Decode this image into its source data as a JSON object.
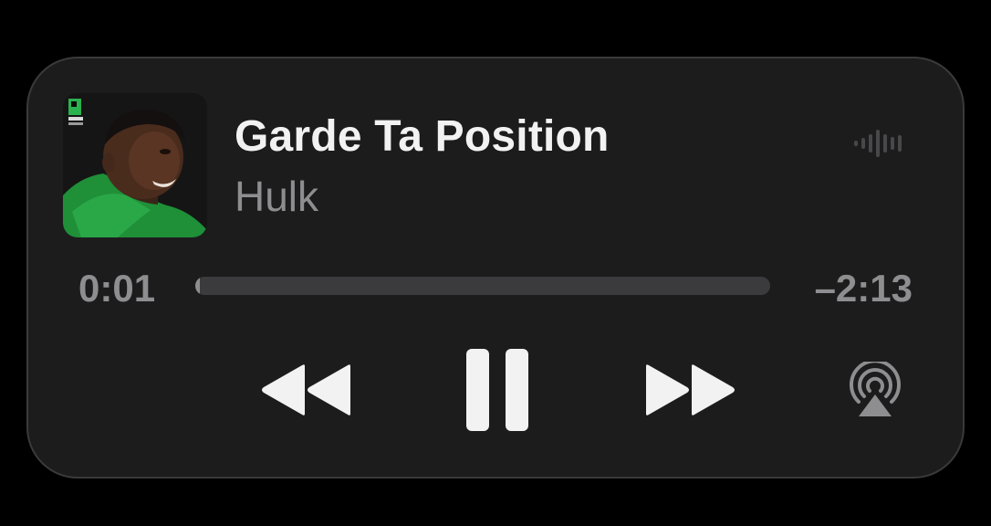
{
  "track": {
    "title": "Garde Ta Position",
    "artist": "Hulk",
    "elapsed": "0:01",
    "remaining": "–2:13",
    "progress_fraction": 0.008
  },
  "controls": {
    "rewind_icon": "backward-icon",
    "pause_icon": "pause-icon",
    "forward_icon": "forward-icon",
    "airplay_icon": "airplay-icon"
  },
  "colors": {
    "background": "#000000",
    "card": "#1c1c1d",
    "primary_text": "#f2f2f2",
    "secondary_text": "#8e8e90",
    "track": "#3b3b3d",
    "accent_green": "#1f9a3c"
  }
}
